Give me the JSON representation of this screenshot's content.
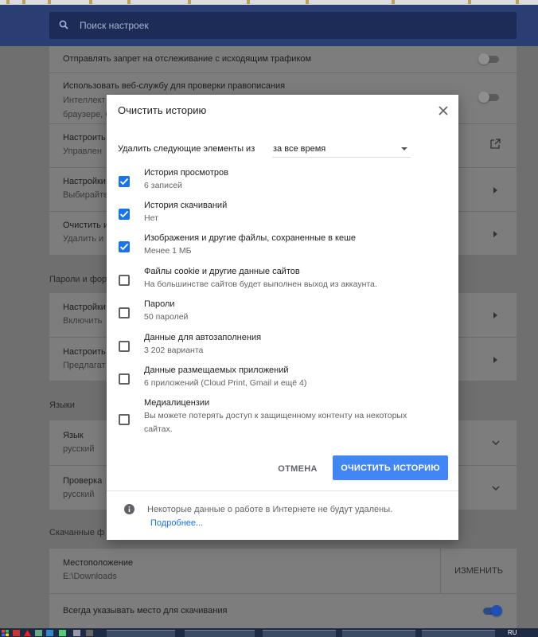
{
  "search": {
    "placeholder": "Поиск настроек"
  },
  "settings": {
    "privacy": [
      {
        "title": "Отправлять запрет на отслеживание с исходящим трафиком",
        "sub": ""
      },
      {
        "title": "Использовать веб-службу для проверки правописания",
        "sub": "Интеллект",
        "sub2": "браузере, G"
      },
      {
        "title": "Настроить",
        "sub": "Управлен"
      },
      {
        "title": "Настройки",
        "sub": "Выбирайте"
      },
      {
        "title": "Очистить и",
        "sub": "Удалить и"
      }
    ],
    "passwords_section": "Пароли и фор",
    "passwords": [
      {
        "title": "Настройки",
        "sub": "Включить"
      },
      {
        "title": "Настроить",
        "sub": "Предлагат"
      }
    ],
    "languages_section": "Языки",
    "languages": [
      {
        "title": "Язык",
        "sub": "русский"
      },
      {
        "title": "Проверка",
        "sub": "русский"
      }
    ],
    "downloads_section": "Скачанные ф",
    "downloads": {
      "location_label": "Местоположение",
      "location_value": "E:\\Downloads",
      "change_button": "ИЗМЕНИТЬ",
      "ask_label": "Всегда указывать место для скачивания"
    }
  },
  "dialog": {
    "title": "Очистить историю",
    "range_label": "Удалить следующие элементы из",
    "range_value": "за все время",
    "items": [
      {
        "label": "История просмотров",
        "detail": "6 записей",
        "checked": true
      },
      {
        "label": "История скачиваний",
        "detail": "Нет",
        "checked": true
      },
      {
        "label": "Изображения и другие файлы, сохраненные в кеше",
        "detail": "Менее 1 МБ",
        "checked": true
      },
      {
        "label": "Файлы cookie и другие данные сайтов",
        "detail": "На большинстве сайтов будет выполнен выход из аккаунта.",
        "checked": false
      },
      {
        "label": "Пароли",
        "detail": "50 паролей",
        "checked": false
      },
      {
        "label": "Данные для автозаполнения",
        "detail": "3 202 варианта",
        "checked": false
      },
      {
        "label": "Данные размещаемых приложений",
        "detail": "6 приложений (Cloud Print, Gmail и ещё 4)",
        "checked": false
      },
      {
        "label": "Медиалицензии",
        "detail": "Вы можете потерять доступ к защищенному контенту на некоторых",
        "detail2": "сайтах.",
        "checked": false
      }
    ],
    "cancel_label": "ОТМЕНА",
    "clear_label": "ОЧИСТИТЬ ИСТОРИЮ",
    "footer_text": "Некоторые данные о работе в Интернете не будут удалены.",
    "footer_link": "Подробнее..."
  },
  "taskbar": {
    "lang": "RU"
  },
  "colors": {
    "accent": "#1a73e8",
    "button": "#4285f4",
    "header": "#2b3e73"
  }
}
